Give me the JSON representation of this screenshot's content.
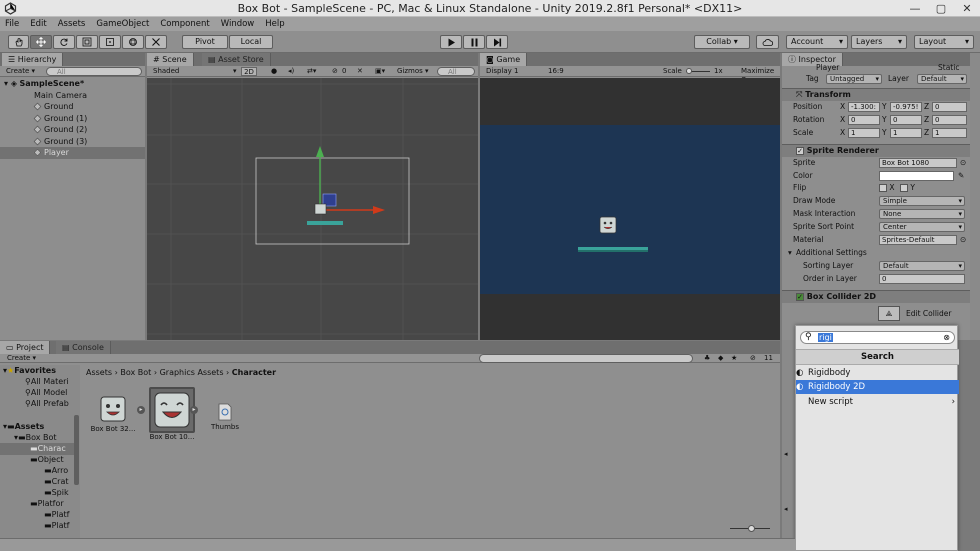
{
  "window": {
    "title": "Box Bot - SampleScene - PC, Mac & Linux Standalone - Unity 2019.2.8f1 Personal* <DX11>",
    "minimize": "—",
    "maximize": "▢",
    "close": "✕"
  },
  "menu": [
    "File",
    "Edit",
    "Assets",
    "GameObject",
    "Component",
    "Window",
    "Help"
  ],
  "toolbar": {
    "pivot": "Pivot",
    "local": "Local",
    "collab": "Collab ▾",
    "account": "Account",
    "layers": "Layers",
    "layout": "Layout"
  },
  "hierarchy": {
    "tab": "Hierarchy",
    "create": "Create ▾",
    "search_placeholder": "All",
    "scene": "SampleScene*",
    "items": [
      "Main Camera",
      "Ground",
      "Ground (1)",
      "Ground (2)",
      "Ground (3)",
      "Player"
    ]
  },
  "scene": {
    "tab": "Scene",
    "asset_store_tab": "Asset Store",
    "shading": "Shaded",
    "mode_2d": "2D",
    "fx_count": "0",
    "gizmos": "Gizmos ▾",
    "search_placeholder": "All"
  },
  "game": {
    "tab": "Game",
    "display": "Display 1",
    "aspect": "16:9",
    "scale_label": "Scale",
    "scale_value": "1x",
    "maximize": "Maximize O"
  },
  "inspector": {
    "tab": "Inspector",
    "object_name": "Player",
    "static_label": "Static",
    "tag_label": "Tag",
    "tag_value": "Untagged",
    "layer_label": "Layer",
    "layer_value": "Default",
    "transform": {
      "title": "Transform",
      "position": {
        "label": "Position",
        "x": "-1.300:",
        "y": "-0.975!",
        "z": "0"
      },
      "rotation": {
        "label": "Rotation",
        "x": "0",
        "y": "0",
        "z": "0"
      },
      "scale": {
        "label": "Scale",
        "x": "1",
        "y": "1",
        "z": "1"
      }
    },
    "sprite_renderer": {
      "title": "Sprite Renderer",
      "sprite_label": "Sprite",
      "sprite_value": "Box Bot 1080",
      "color_label": "Color",
      "flip_label": "Flip",
      "flip_x": "X",
      "flip_y": "Y",
      "draw_mode_label": "Draw Mode",
      "draw_mode_value": "Simple",
      "mask_label": "Mask Interaction",
      "mask_value": "None",
      "sort_point_label": "Sprite Sort Point",
      "sort_point_value": "Center",
      "material_label": "Material",
      "material_value": "Sprites-Default",
      "additional": "Additional Settings",
      "sorting_layer_label": "Sorting Layer",
      "sorting_layer_value": "Default",
      "order_label": "Order in Layer",
      "order_value": "0"
    },
    "box_collider": {
      "title": "Box Collider 2D",
      "edit_collider": "Edit Collider"
    }
  },
  "add_component_popup": {
    "search_value": "rigi",
    "header": "Search",
    "items": [
      "Rigidbody",
      "Rigidbody 2D",
      "New script"
    ],
    "selected_index": 1
  },
  "project": {
    "tab": "Project",
    "console_tab": "Console",
    "create": "Create ▾",
    "favorites": "Favorites",
    "favorites_items": [
      "All Materi",
      "All Model",
      "All Prefab"
    ],
    "assets": "Assets",
    "tree": [
      "Box Bot",
      "Charac",
      "Object",
      "Arro",
      "Crat",
      "Spik",
      "Platfor",
      "Platf",
      "Platf"
    ],
    "breadcrumb": [
      "Assets",
      "Box Bot",
      "Graphics Assets",
      "Character"
    ],
    "hidden_count": "11",
    "files": [
      "Box Bot 32...",
      "Box Bot 10...",
      "Thumbs"
    ]
  },
  "colors": {
    "game_sky": "#1d3553",
    "popup_selection": "#3a78d8",
    "gizmo_y": "#4caf50",
    "gizmo_x": "#d03a1a",
    "ground_teal": "#3aa39a"
  }
}
